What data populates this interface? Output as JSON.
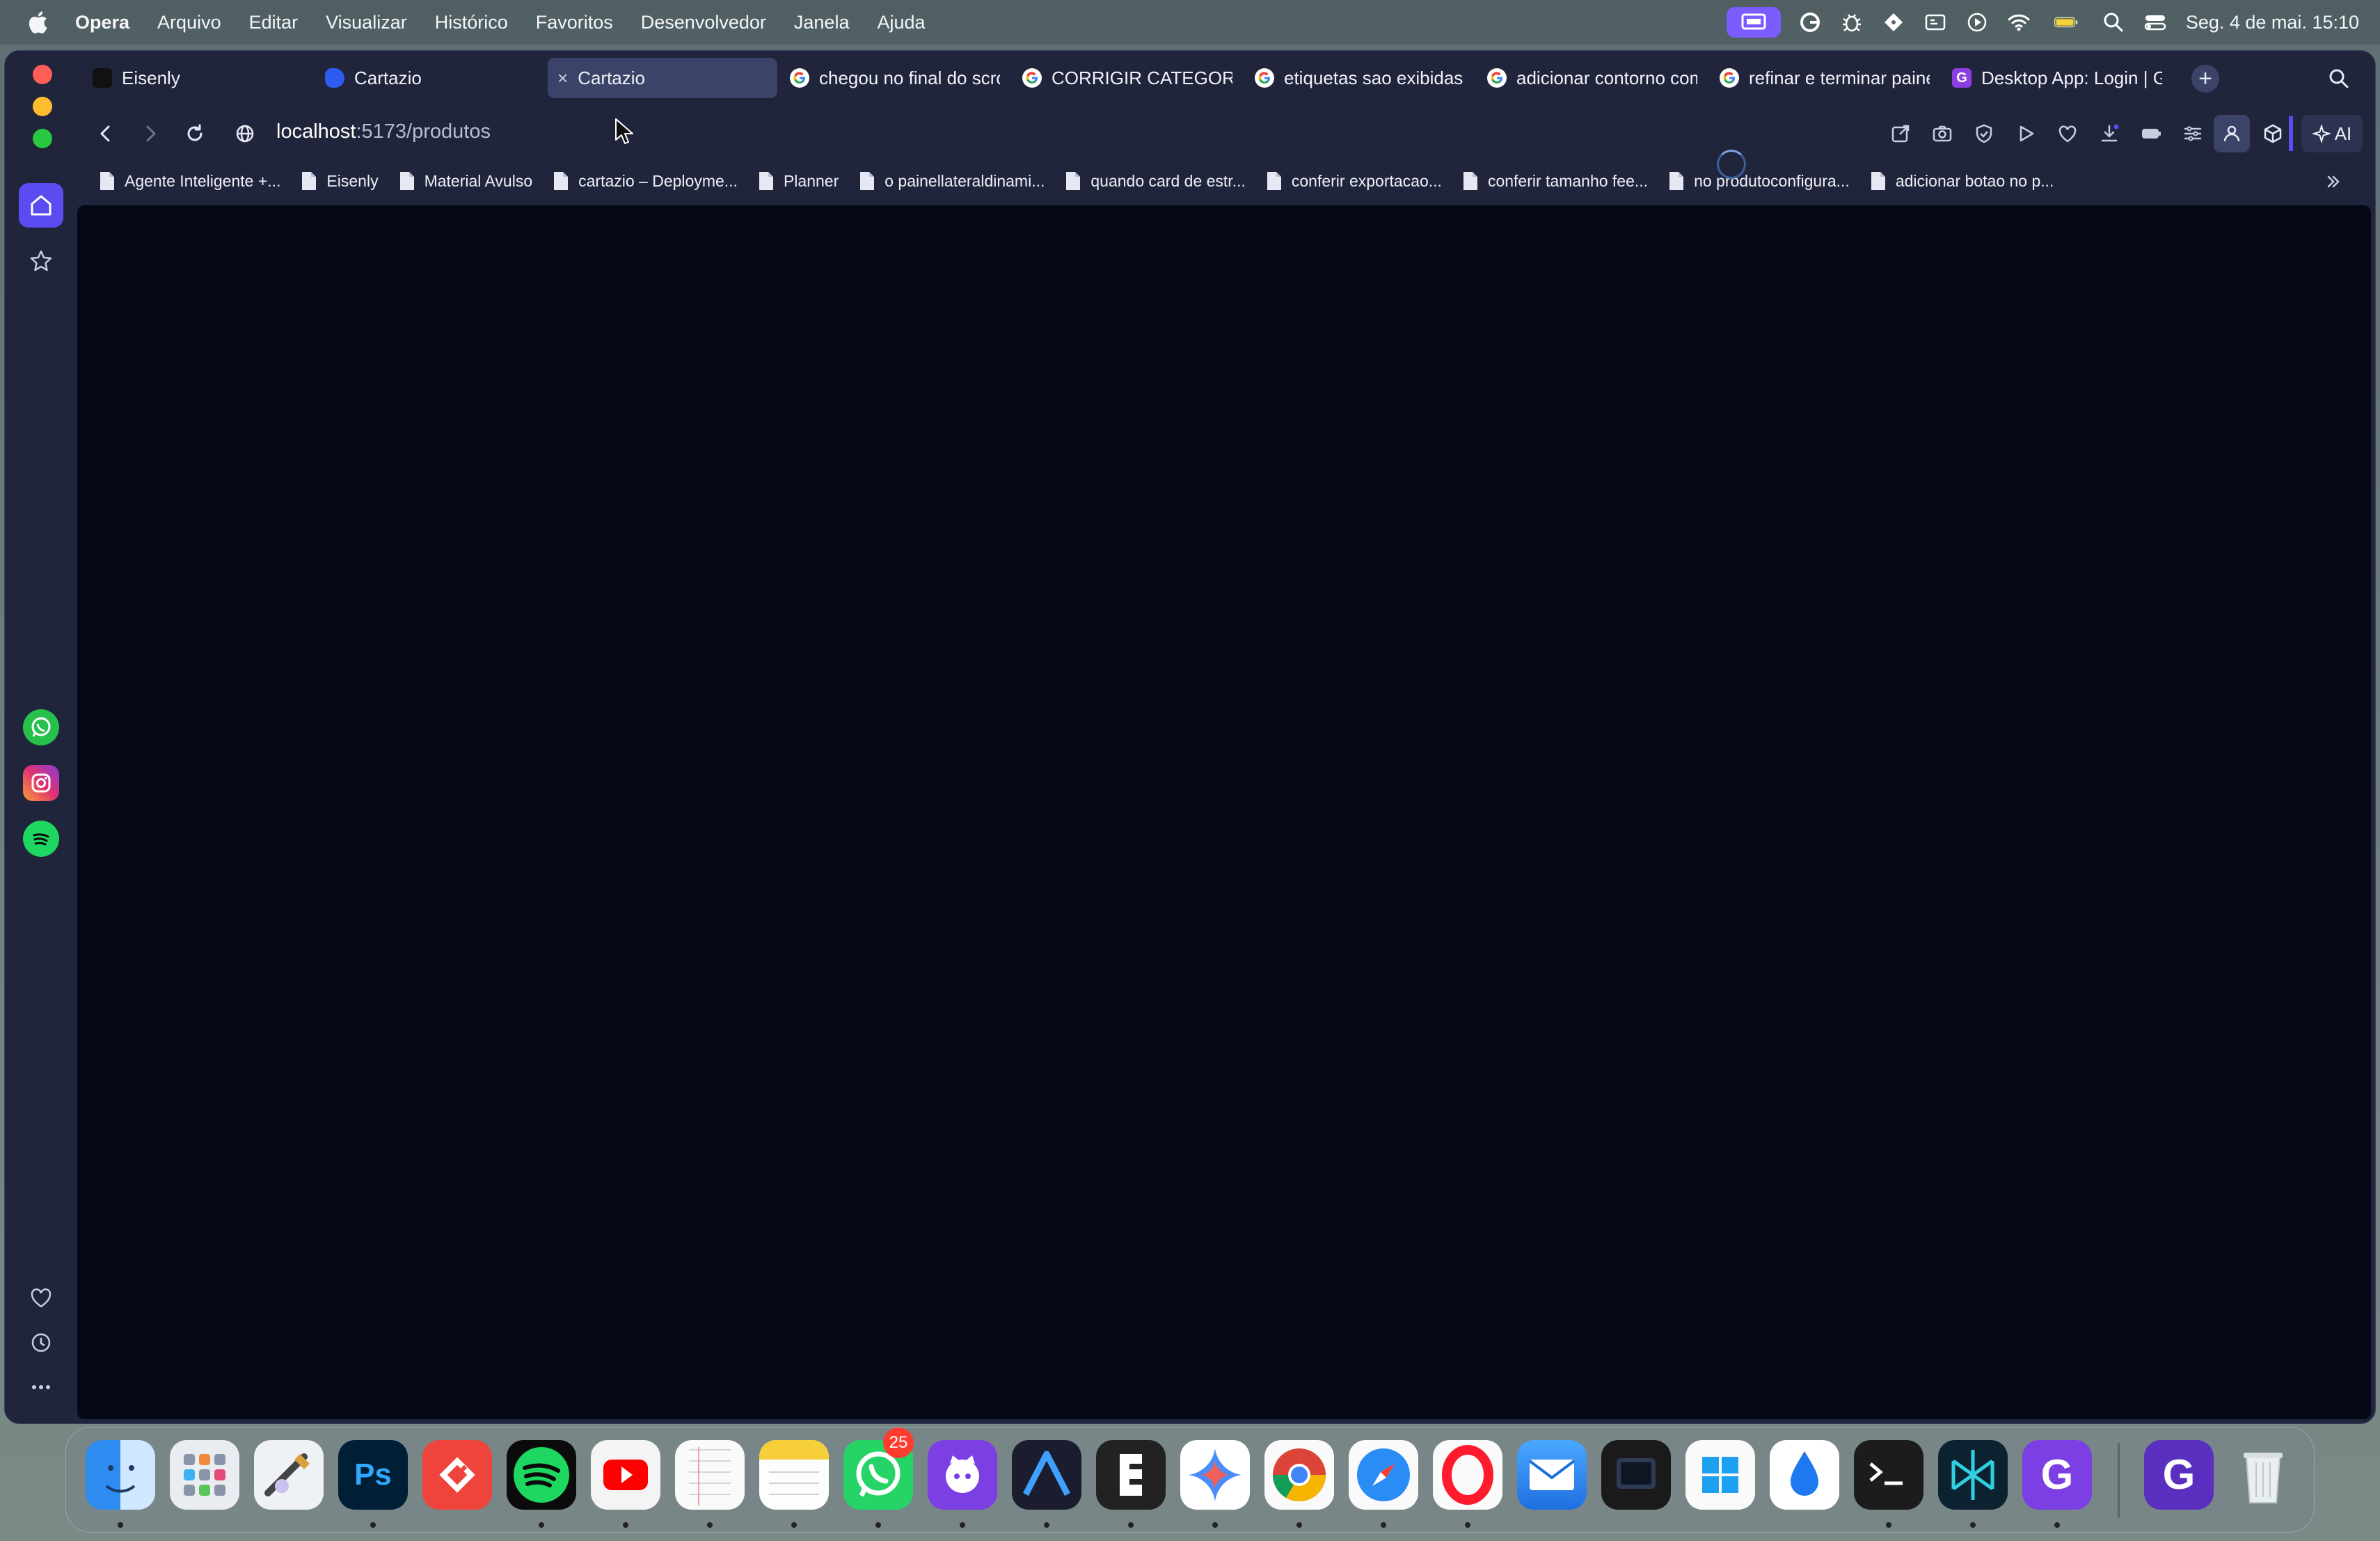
{
  "menubar": {
    "app_name": "Opera",
    "items": [
      "Arquivo",
      "Editar",
      "Visualizar",
      "Histórico",
      "Favoritos",
      "Desenvolvedor",
      "Janela",
      "Ajuda"
    ],
    "clock": "Seg. 4 de mai.  15:10",
    "status_icons": [
      "screen-mirroring-icon",
      "grammarly-icon",
      "bug-icon",
      "tag-icon",
      "display-icon",
      "play-circle-icon",
      "wifi-icon",
      "battery-icon",
      "spotlight-search-icon",
      "control-center-icon"
    ]
  },
  "tabs": [
    {
      "label": "Eisenly",
      "favicon": "black-square",
      "active": false
    },
    {
      "label": "Cartazio",
      "favicon": "blue-blob",
      "active": false
    },
    {
      "label": "Cartazio",
      "favicon": "none",
      "active": true,
      "close": "×"
    },
    {
      "label": "chegou no final do scroll",
      "favicon": "google",
      "active": false
    },
    {
      "label": "CORRIGIR CATEGORIAS",
      "favicon": "google",
      "active": false
    },
    {
      "label": "etiquetas sao exibidas c",
      "favicon": "google",
      "active": false
    },
    {
      "label": "adicionar contorno com",
      "favicon": "google",
      "active": false
    },
    {
      "label": "refinar e terminar painell",
      "favicon": "google",
      "active": false
    },
    {
      "label": "Desktop App: Login | Gli",
      "favicon": "glif",
      "active": false
    }
  ],
  "new_tab": "+",
  "address": {
    "host": "localhost",
    "path": ":5173/produtos"
  },
  "ai_button": "AI",
  "bookmarks": [
    "Agente Inteligente +...",
    "Eisenly",
    "Material Avulso",
    "cartazio – Deployme...",
    "Planner",
    "o painellateraldinami...",
    "quando card de estr...",
    "conferir exportacao...",
    "conferir tamanho fee...",
    "no produtoconfigura...",
    "adicionar botao no p..."
  ],
  "colors": {
    "accent": "#5a4cf0",
    "page_bg": "#050816",
    "chrome_bg": "#20253b",
    "active_tab": "#3b4368"
  },
  "dock": {
    "apps": [
      "finder",
      "launchpad",
      "rocket-typist",
      "photoshop",
      "anydesk",
      "spotify",
      "youtube",
      "notes-grid",
      "notes",
      "whatsapp",
      "github-desktop",
      "affinity",
      "capcut",
      "gemini",
      "chrome",
      "safari",
      "opera",
      "mail",
      "terminal-dark",
      "windows-app",
      "drop",
      "terminal",
      "perplexity",
      "glif",
      "glif-alt",
      "trash"
    ],
    "whatsapp_badge": "25"
  }
}
